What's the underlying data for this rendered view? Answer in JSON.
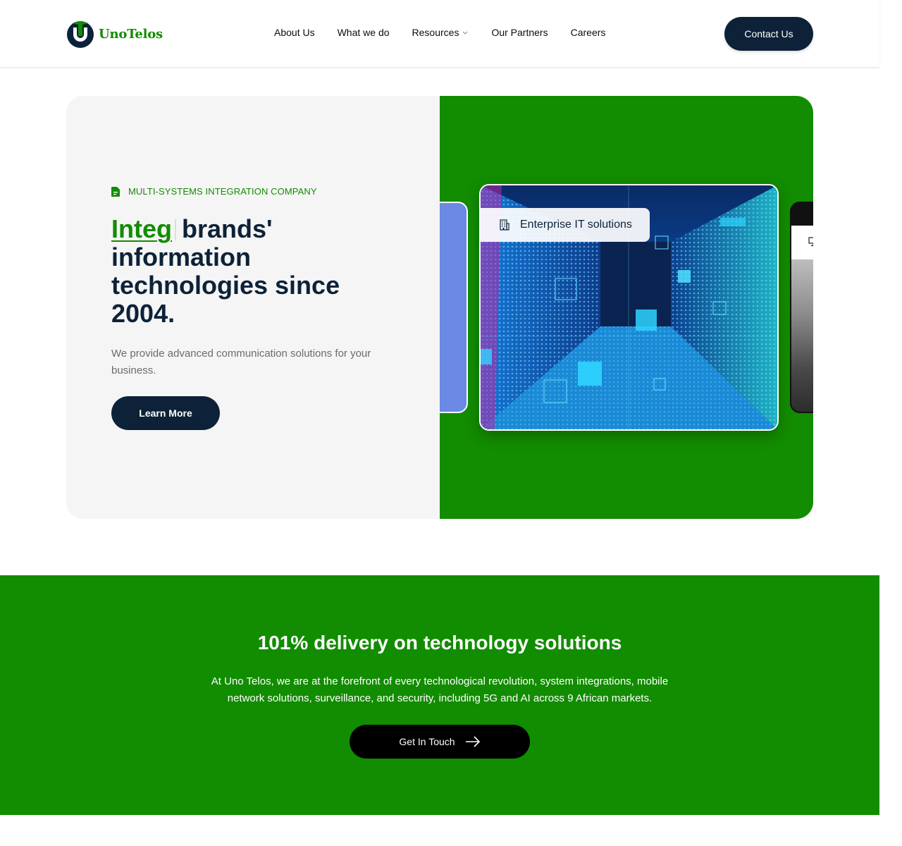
{
  "header": {
    "logo_text": "UnoTelos",
    "nav": [
      {
        "label": "About Us"
      },
      {
        "label": "What we do"
      },
      {
        "label": "Resources",
        "has_dropdown": true
      },
      {
        "label": "Our Partners"
      },
      {
        "label": "Careers"
      }
    ],
    "contact_label": "Contact Us"
  },
  "hero": {
    "eyebrow": "MULTI-SYSTEMS INTEGRATION COMPANY",
    "headline_accent": "Integ",
    "headline_rest": "brands' information technologies since 2004.",
    "subtitle": "We provide advanced communication solutions for your business.",
    "cta_label": "Learn More",
    "card_tag": "Enterprise IT solutions"
  },
  "band": {
    "title": "101% delivery on technology solutions",
    "text": "At Uno Telos, we are at the forefront of every technological revolution, system integrations, mobile network solutions, surveillance, and security, including 5G and AI across 9 African markets.",
    "cta_label": "Get In Touch"
  },
  "colors": {
    "brand_green": "#128c00",
    "navy": "#0d2238",
    "hero_left_bg": "#f5f5f5",
    "card_blue": "#6b8ae6"
  },
  "icons": {
    "eyebrow": "document-icon",
    "card_tag": "building-icon",
    "dropdown": "chevron-down-icon",
    "cta": "arrow-right-icon"
  }
}
